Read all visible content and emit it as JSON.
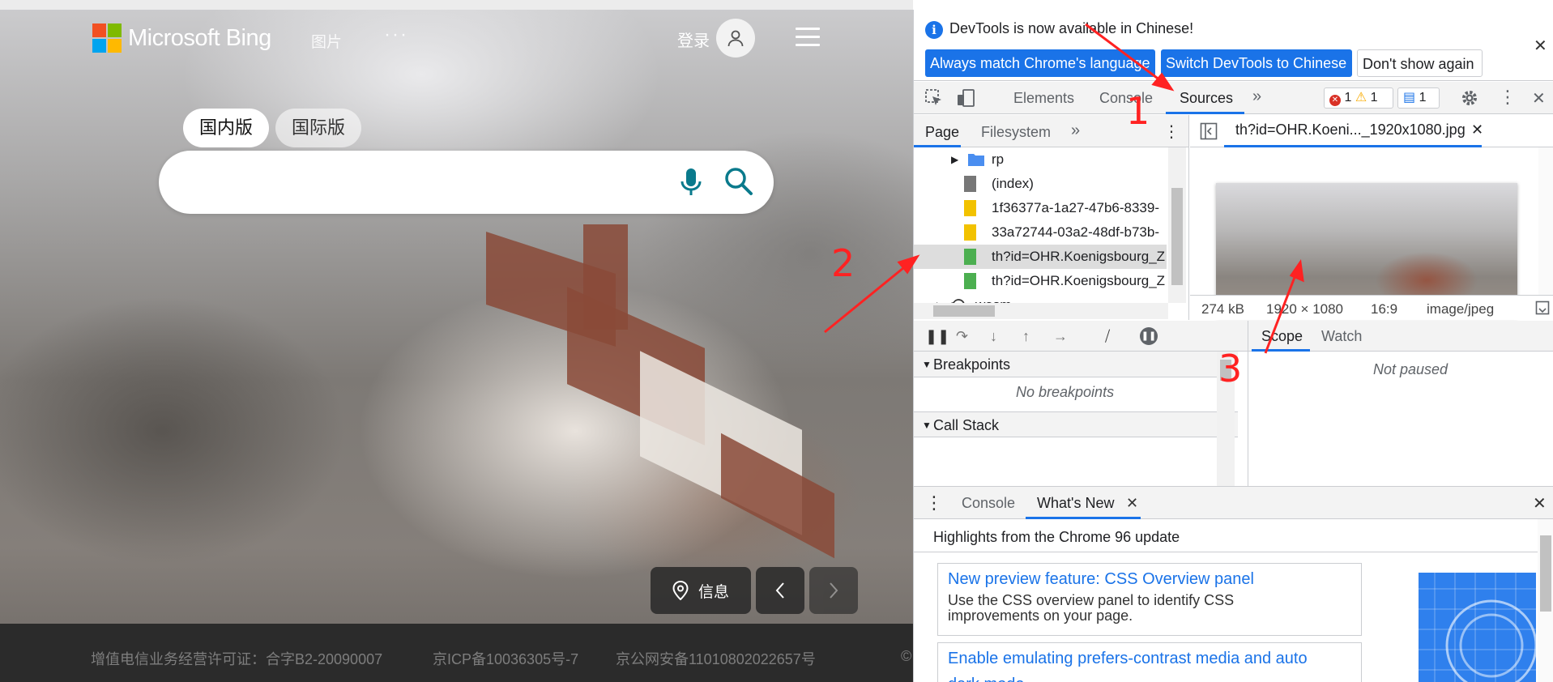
{
  "bing": {
    "logo_text": "Microsoft Bing",
    "nav_images": "图片",
    "nav_more": "···",
    "login": "登录",
    "scope_tabs": [
      "国内版",
      "国际版"
    ],
    "info_label": "信息",
    "footer": [
      "增值电信业务经营许可证：合字B2-20090007",
      "京ICP备10036305号-7",
      "京公网安备11010802022657号",
      "©"
    ]
  },
  "annotations": [
    "1",
    "2",
    "3"
  ],
  "devtools": {
    "notice": {
      "text": "DevTools is now available in Chinese!",
      "btn_match": "Always match Chrome's language",
      "btn_switch": "Switch DevTools to Chinese",
      "btn_dismiss": "Don't show again"
    },
    "tabs": [
      "Elements",
      "Console",
      "Sources"
    ],
    "errors": "1",
    "warnings": "1",
    "messages": "1",
    "subtabs": [
      "Page",
      "Filesystem"
    ],
    "tree": [
      {
        "label": "rp",
        "type": "folder"
      },
      {
        "label": "(index)",
        "type": "doc"
      },
      {
        "label": "1f36377a-1a27-47b6-8339-",
        "type": "script"
      },
      {
        "label": "33a72744-03a2-48df-b73b-",
        "type": "script"
      },
      {
        "label": "th?id=OHR.Koenigsbourg_Z",
        "type": "image"
      },
      {
        "label": "th?id=OHR.Koenigsbourg_Z",
        "type": "image"
      },
      {
        "label": "wasm",
        "type": "cloud"
      }
    ],
    "open_file": "th?id=OHR.Koeni..._1920x1080.jpg",
    "image_info": {
      "size": "274 kB",
      "dims": "1920 × 1080",
      "ratio": "16:9",
      "mime": "image/jpeg"
    },
    "scope_tabs": [
      "Scope",
      "Watch"
    ],
    "not_paused": "Not paused",
    "breakpoints": "Breakpoints",
    "no_breakpoints": "No breakpoints",
    "call_stack": "Call Stack",
    "drawer_tabs": [
      "Console",
      "What's New"
    ],
    "whats_new_title": "Highlights from the Chrome 96 update",
    "cards": [
      {
        "title": "New preview feature: CSS Overview panel",
        "desc": "Use the CSS overview panel to identify CSS improvements on your page."
      },
      {
        "title": "Enable emulating prefers-contrast media and auto",
        "desc": "dark mode"
      }
    ]
  },
  "colors": {
    "accent": "#1a73e8",
    "annotation": "#ff2222",
    "error": "#d93025",
    "warning": "#f9ab00"
  }
}
